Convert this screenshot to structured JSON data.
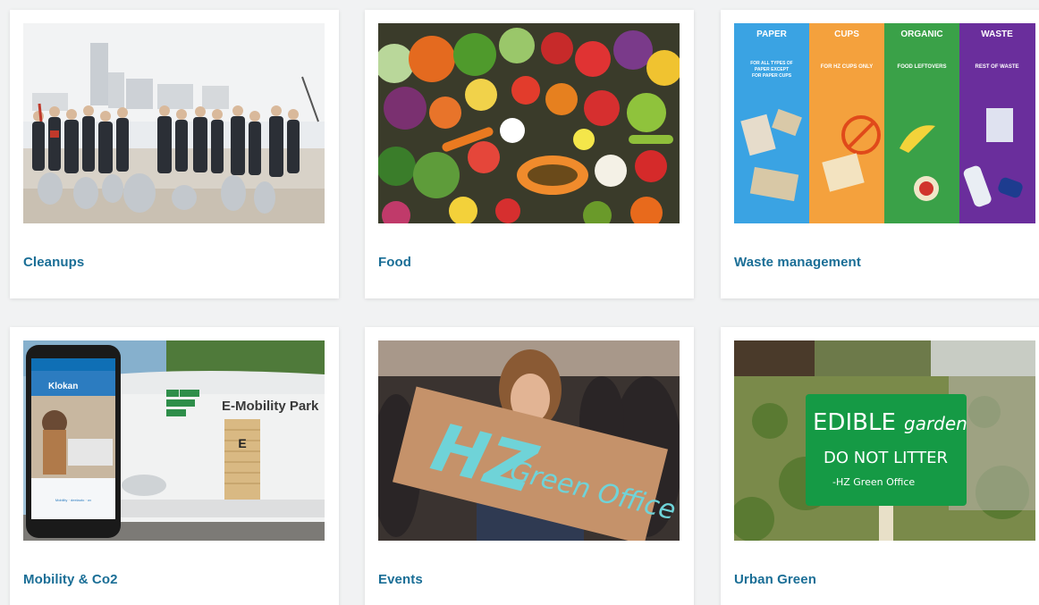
{
  "cards": [
    {
      "title": "Cleanups",
      "image_icon": "cleanup-photo"
    },
    {
      "title": "Food",
      "image_icon": "vegetables-photo"
    },
    {
      "title": "Waste management",
      "image_icon": "waste-bins-photo",
      "bins": [
        {
          "label": "PAPER",
          "text": "FOR ALL TYPES OF PAPER EXCEPT FOR PAPER CUPS",
          "color": "#3aa3e3"
        },
        {
          "label": "CUPS",
          "text": "FOR HZ CUPS ONLY",
          "color": "#f4a13d"
        },
        {
          "label": "ORGANIC",
          "text": "FOOD LEFTOVERS",
          "color": "#3aa148"
        },
        {
          "label": "WASTE",
          "text": "REST OF WASTE",
          "color": "#6a2e9c"
        }
      ]
    },
    {
      "title": "Mobility & Co2",
      "image_icon": "e-mobility-photo",
      "sign_text": "E-Mobility Park",
      "app_name": "Klokan",
      "app_footer": "Mobility · deelauto · ov"
    },
    {
      "title": "Events",
      "image_icon": "hz-green-office-sign-photo",
      "sign_line1": "HZ",
      "sign_line2": "Green Office"
    },
    {
      "title": "Urban Green",
      "image_icon": "edible-garden-sign-photo",
      "sign_line1": "EDIBLE",
      "sign_line1b": "garden",
      "sign_line2": "DO NOT LITTER",
      "sign_line3": "-HZ Green Office"
    }
  ],
  "colors": {
    "title": "#1a6e96",
    "background": "#f1f2f3",
    "card": "#ffffff"
  }
}
